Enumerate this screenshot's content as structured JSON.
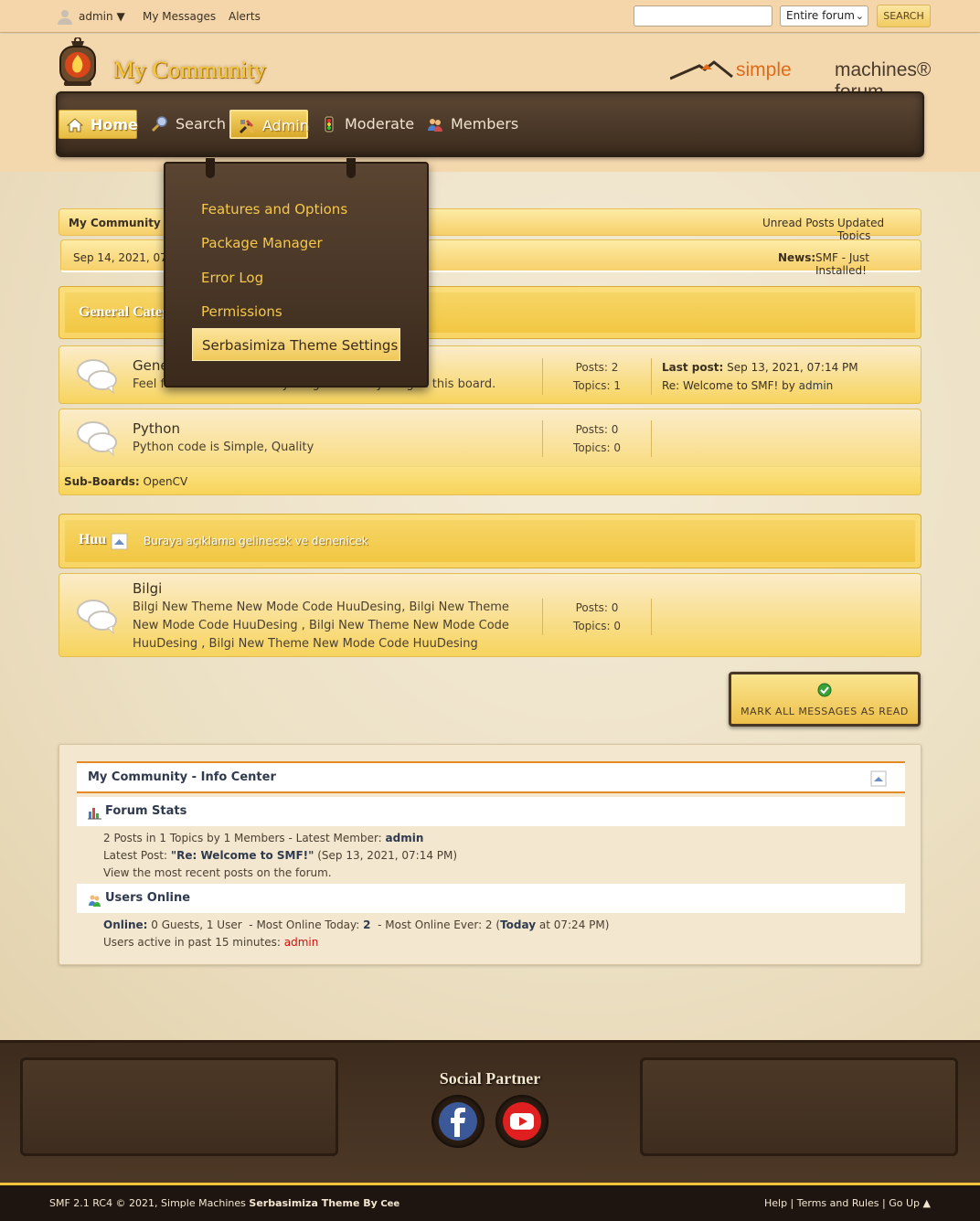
{
  "topbar": {
    "user": "admin",
    "user_caret": "▼",
    "messages": "My Messages",
    "alerts": "Alerts",
    "search_placeholder": "",
    "search_scope": "Entire forum",
    "search_button": "SEARCH"
  },
  "header": {
    "forum_title": "My Community",
    "smf_logo_a": "simple",
    "smf_logo_b": "machines® forum"
  },
  "nav": {
    "items": [
      {
        "label": "Home",
        "icon": "home-icon"
      },
      {
        "label": "Search",
        "icon": "search-icon"
      },
      {
        "label": "Admin",
        "icon": "tools-icon"
      },
      {
        "label": "Moderate",
        "icon": "traffic-light-icon"
      },
      {
        "label": "Members",
        "icon": "members-icon"
      }
    ]
  },
  "admin_menu": {
    "items": [
      {
        "label": "Features and Options"
      },
      {
        "label": "Package Manager"
      },
      {
        "label": "Error Log"
      },
      {
        "label": "Permissions"
      },
      {
        "label": "Serbasimiza Theme Settings"
      }
    ]
  },
  "breadcrumb": {
    "home": "My Community",
    "unread": "Unread Posts",
    "updated": "Updated Topics"
  },
  "upper_section": {
    "date": "Sep 14, 2021, 07:33 PM",
    "news_label": "News:",
    "news_text": "SMF - Just Installed!"
  },
  "categories": [
    {
      "title": "General Category",
      "description": "",
      "boards": [
        {
          "name": "General Discussion",
          "description": "Feel free to talk about anything and everything in this board.",
          "posts": "Posts: 2",
          "topics": "Topics: 1",
          "last_label": "Last post:",
          "last_date": "Sep 13, 2021, 07:14 PM",
          "last_topic": "Re: Welcome to SMF!",
          "last_by": "by",
          "last_user": "admin"
        },
        {
          "name": "Python",
          "description": "Python code is Simple, Quality",
          "posts": "Posts: 0",
          "topics": "Topics: 0",
          "subboards_label": "Sub-Boards:",
          "subboards": "OpenCV"
        }
      ]
    },
    {
      "title": "Huu",
      "description": "Buraya açıklama gelinecek ve denenicek",
      "boards": [
        {
          "name": "Bilgi",
          "description": "Bilgi New Theme New Mode Code HuuDesing, Bilgi New Theme New Mode Code HuuDesing , Bilgi New Theme New Mode Code HuuDesing , Bilgi New Theme New Mode Code HuuDesing",
          "posts": "Posts: 0",
          "topics": "Topics: 0"
        }
      ]
    }
  ],
  "mark_read": {
    "label": "MARK ALL MESSAGES AS READ"
  },
  "info_center": {
    "title": "My Community - Info Center",
    "stats_title": "Forum Stats",
    "stats_line1": "2 Posts in 1 Topics by 1 Members - Latest Member:",
    "stats_latest_member": "admin",
    "stats_line2_label": "Latest Post:",
    "stats_latest_post": "\"Re: Welcome to SMF!\"",
    "stats_latest_date": "(Sep 13, 2021, 07:14 PM)",
    "stats_line3": "View the most recent posts on the forum.",
    "online_title": "Users Online",
    "online_label": "Online:",
    "online_counts": "0 Guests, 1 User",
    "online_today_label": "- Most Online Today:",
    "online_today": "2",
    "online_ever_label": "- Most Online Ever: 2 (",
    "online_ever_today": "Today",
    "online_ever_time": "at 07:24 PM)",
    "active_label": "Users active in past 15 minutes:",
    "active_user": "admin"
  },
  "footer": {
    "social_title": "Social Partner",
    "copyright": "SMF 2.1 RC4 © 2021, Simple Machines",
    "theme_by": "Serbasimiza Theme By",
    "author": "Cee",
    "help": "Help",
    "terms": "Terms and Rules",
    "goup": "Go Up ▲",
    "sep": "|"
  },
  "colors": {
    "accent_gold": "#f5c832",
    "wood_dark": "#3b2b1d",
    "link_red": "#d01010",
    "info_orange": "#e48a24"
  }
}
